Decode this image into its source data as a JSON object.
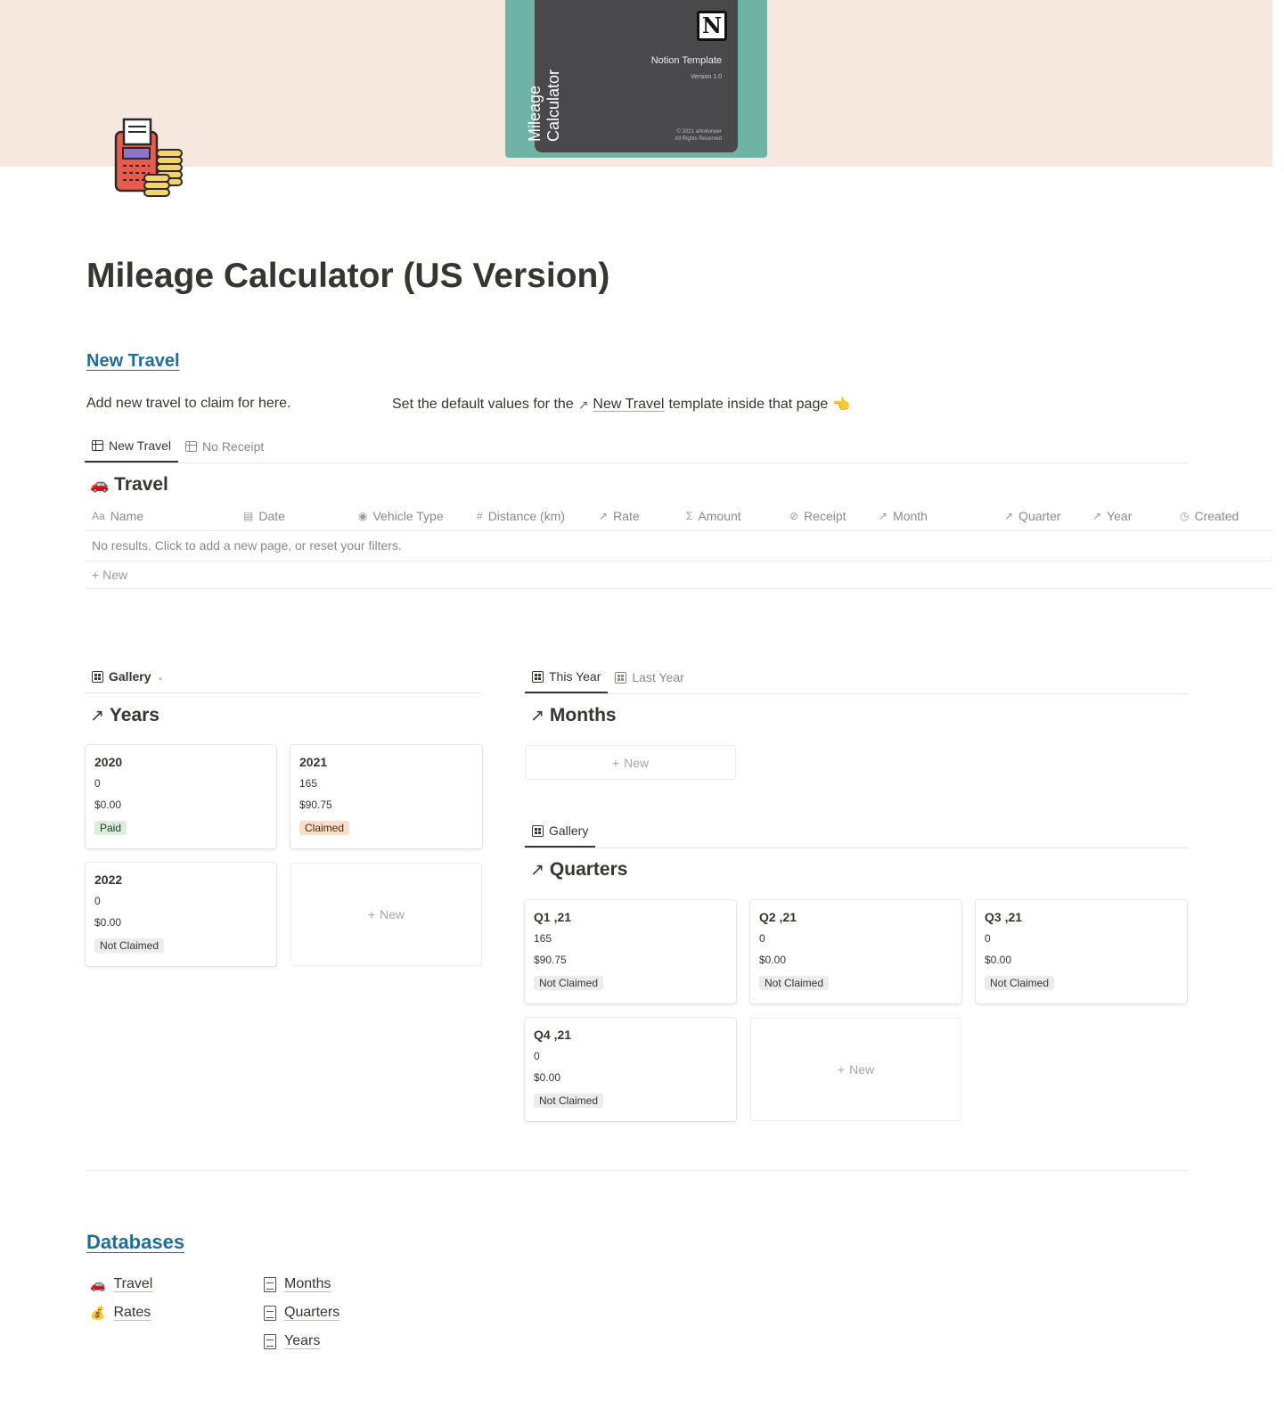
{
  "cover": {
    "template_label": "Notion Template",
    "version": "Version 1.0",
    "copyright_line1": "© 2021 aNotioneer",
    "copyright_line2": "All Rights Reserved",
    "vertical_title": "Mileage Calculator",
    "logo_letter": "N",
    "bg_color": "#f6e8df",
    "card_color": "#6fb3a5"
  },
  "page": {
    "title": "Mileage Calculator (US Version)"
  },
  "new_travel_section": {
    "heading": "New Travel",
    "description": "Add new travel to claim for here.",
    "hint_prefix": "Set the default values for the",
    "hint_link": "New Travel",
    "hint_suffix": "template inside that page",
    "hint_emoji": "👈"
  },
  "travel_db": {
    "tabs": [
      "New Travel",
      "No Receipt"
    ],
    "title": "Travel",
    "columns": [
      {
        "label": "Name",
        "icon": "Aa"
      },
      {
        "label": "Date",
        "icon": "calendar-icon"
      },
      {
        "label": "Vehicle Type",
        "icon": "select-icon"
      },
      {
        "label": "Distance (km)",
        "icon": "#"
      },
      {
        "label": "Rate",
        "icon": "relation-icon"
      },
      {
        "label": "Amount",
        "icon": "Σ"
      },
      {
        "label": "Receipt",
        "icon": "paperclip-icon"
      },
      {
        "label": "Month",
        "icon": "relation-icon"
      },
      {
        "label": "Quarter",
        "icon": "relation-icon"
      },
      {
        "label": "Year",
        "icon": "relation-icon"
      },
      {
        "label": "Created",
        "icon": "clock-icon"
      }
    ],
    "empty_message": "No results. Click to add a new page, or reset your filters.",
    "new_label": "New"
  },
  "years_db": {
    "view_label": "Gallery",
    "title": "Years",
    "cards": [
      {
        "title": "2020",
        "distance": "0",
        "amount": "$0.00",
        "status": "Paid"
      },
      {
        "title": "2021",
        "distance": "165",
        "amount": "$90.75",
        "status": "Claimed"
      },
      {
        "title": "2022",
        "distance": "0",
        "amount": "$0.00",
        "status": "Not Claimed"
      }
    ],
    "new_label": "New"
  },
  "months_db": {
    "tabs": [
      "This Year",
      "Last Year"
    ],
    "title": "Months",
    "new_label": "New"
  },
  "quarters_db": {
    "view_label": "Gallery",
    "title": "Quarters",
    "cards": [
      {
        "title": "Q1 ,21",
        "distance": "165",
        "amount": "$90.75",
        "status": "Not Claimed"
      },
      {
        "title": "Q2 ,21",
        "distance": "0",
        "amount": "$0.00",
        "status": "Not Claimed"
      },
      {
        "title": "Q3 ,21",
        "distance": "0",
        "amount": "$0.00",
        "status": "Not Claimed"
      },
      {
        "title": "Q4 ,21",
        "distance": "0",
        "amount": "$0.00",
        "status": "Not Claimed"
      }
    ],
    "new_label": "New"
  },
  "databases_section": {
    "heading": "Databases",
    "links": [
      {
        "label": "Travel",
        "icon": "car-icon"
      },
      {
        "label": "Rates",
        "icon": "coins-icon"
      },
      {
        "label": "Months",
        "icon": "page-icon"
      },
      {
        "label": "Quarters",
        "icon": "page-icon"
      },
      {
        "label": "Years",
        "icon": "page-icon"
      }
    ]
  },
  "colors": {
    "link_blue": "#1f6e99",
    "tag_paid": "#dbeddb",
    "tag_claimed": "#fadec9",
    "tag_not_claimed": "#ececec"
  }
}
